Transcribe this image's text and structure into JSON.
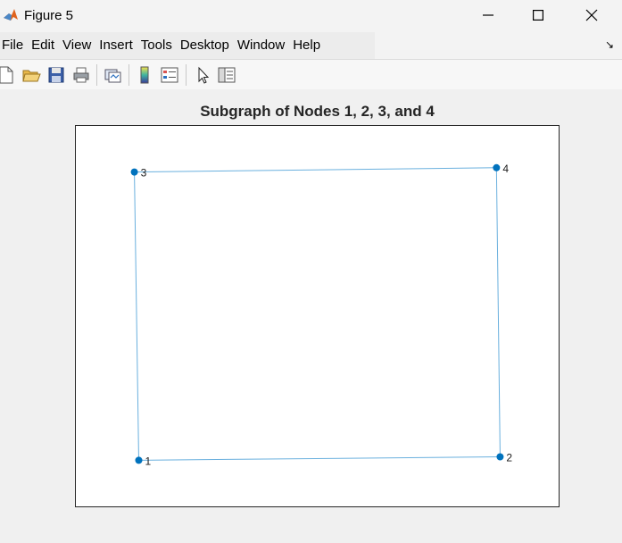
{
  "window": {
    "title": "Figure 5"
  },
  "menu": [
    "File",
    "Edit",
    "View",
    "Insert",
    "Tools",
    "Desktop",
    "Window",
    "Help"
  ],
  "toolbar": {
    "icons": [
      "new-figure-icon",
      "open-file-icon",
      "save-icon",
      "print-icon",
      "link-plot-icon",
      "insert-colorbar-icon",
      "insert-legend-icon",
      "edit-plot-icon",
      "property-inspector-icon"
    ]
  },
  "plot": {
    "title": "Subgraph of Nodes 1, 2, 3, and 4"
  },
  "chart_data": {
    "type": "scatter",
    "nodes": [
      {
        "label": "1",
        "x": 0.012,
        "y": 0.0
      },
      {
        "label": "2",
        "x": 1.0,
        "y": 0.012
      },
      {
        "label": "3",
        "x": 0.0,
        "y": 1.0
      },
      {
        "label": "4",
        "x": 0.99,
        "y": 1.015
      }
    ],
    "edges": [
      [
        "1",
        "2"
      ],
      [
        "1",
        "3"
      ],
      [
        "2",
        "4"
      ],
      [
        "3",
        "4"
      ]
    ],
    "xlim": [
      -0.16,
      1.16
    ],
    "ylim": [
      -0.16,
      1.16
    ],
    "axis_ticks_visible": false,
    "grid": false,
    "node_color": "#0072BD",
    "edge_color": "#6ab0de"
  }
}
